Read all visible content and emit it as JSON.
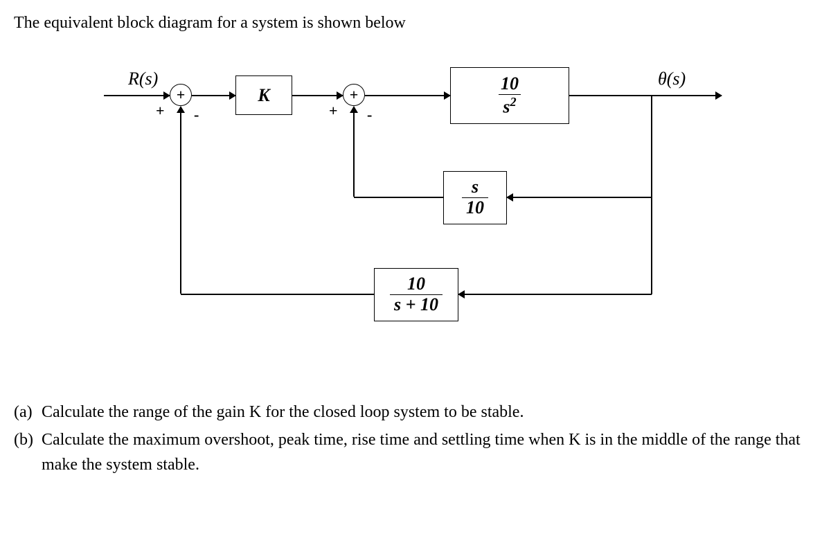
{
  "title": "The equivalent block diagram for a system is shown below",
  "input_label": "R(s)",
  "output_label": "θ(s)",
  "blocks": {
    "K": "K",
    "plant_num": "10",
    "plant_den_base": "s",
    "plant_den_exp": "2",
    "inner_fb_num": "s",
    "inner_fb_den": "10",
    "outer_fb_num": "10",
    "outer_fb_den": "s + 10"
  },
  "sum_symbol": "+",
  "signs": {
    "s1_top": "+",
    "s1_bottom": "-",
    "s2_top": "+",
    "s2_bottom": "-"
  },
  "questions": {
    "a_label": "(a)",
    "a_text": "Calculate the range of the gain K for the closed loop system to be stable.",
    "b_label": "(b)",
    "b_text": "Calculate the maximum overshoot, peak time, rise time and settling time when K is in the middle of the range that make the system stable."
  }
}
